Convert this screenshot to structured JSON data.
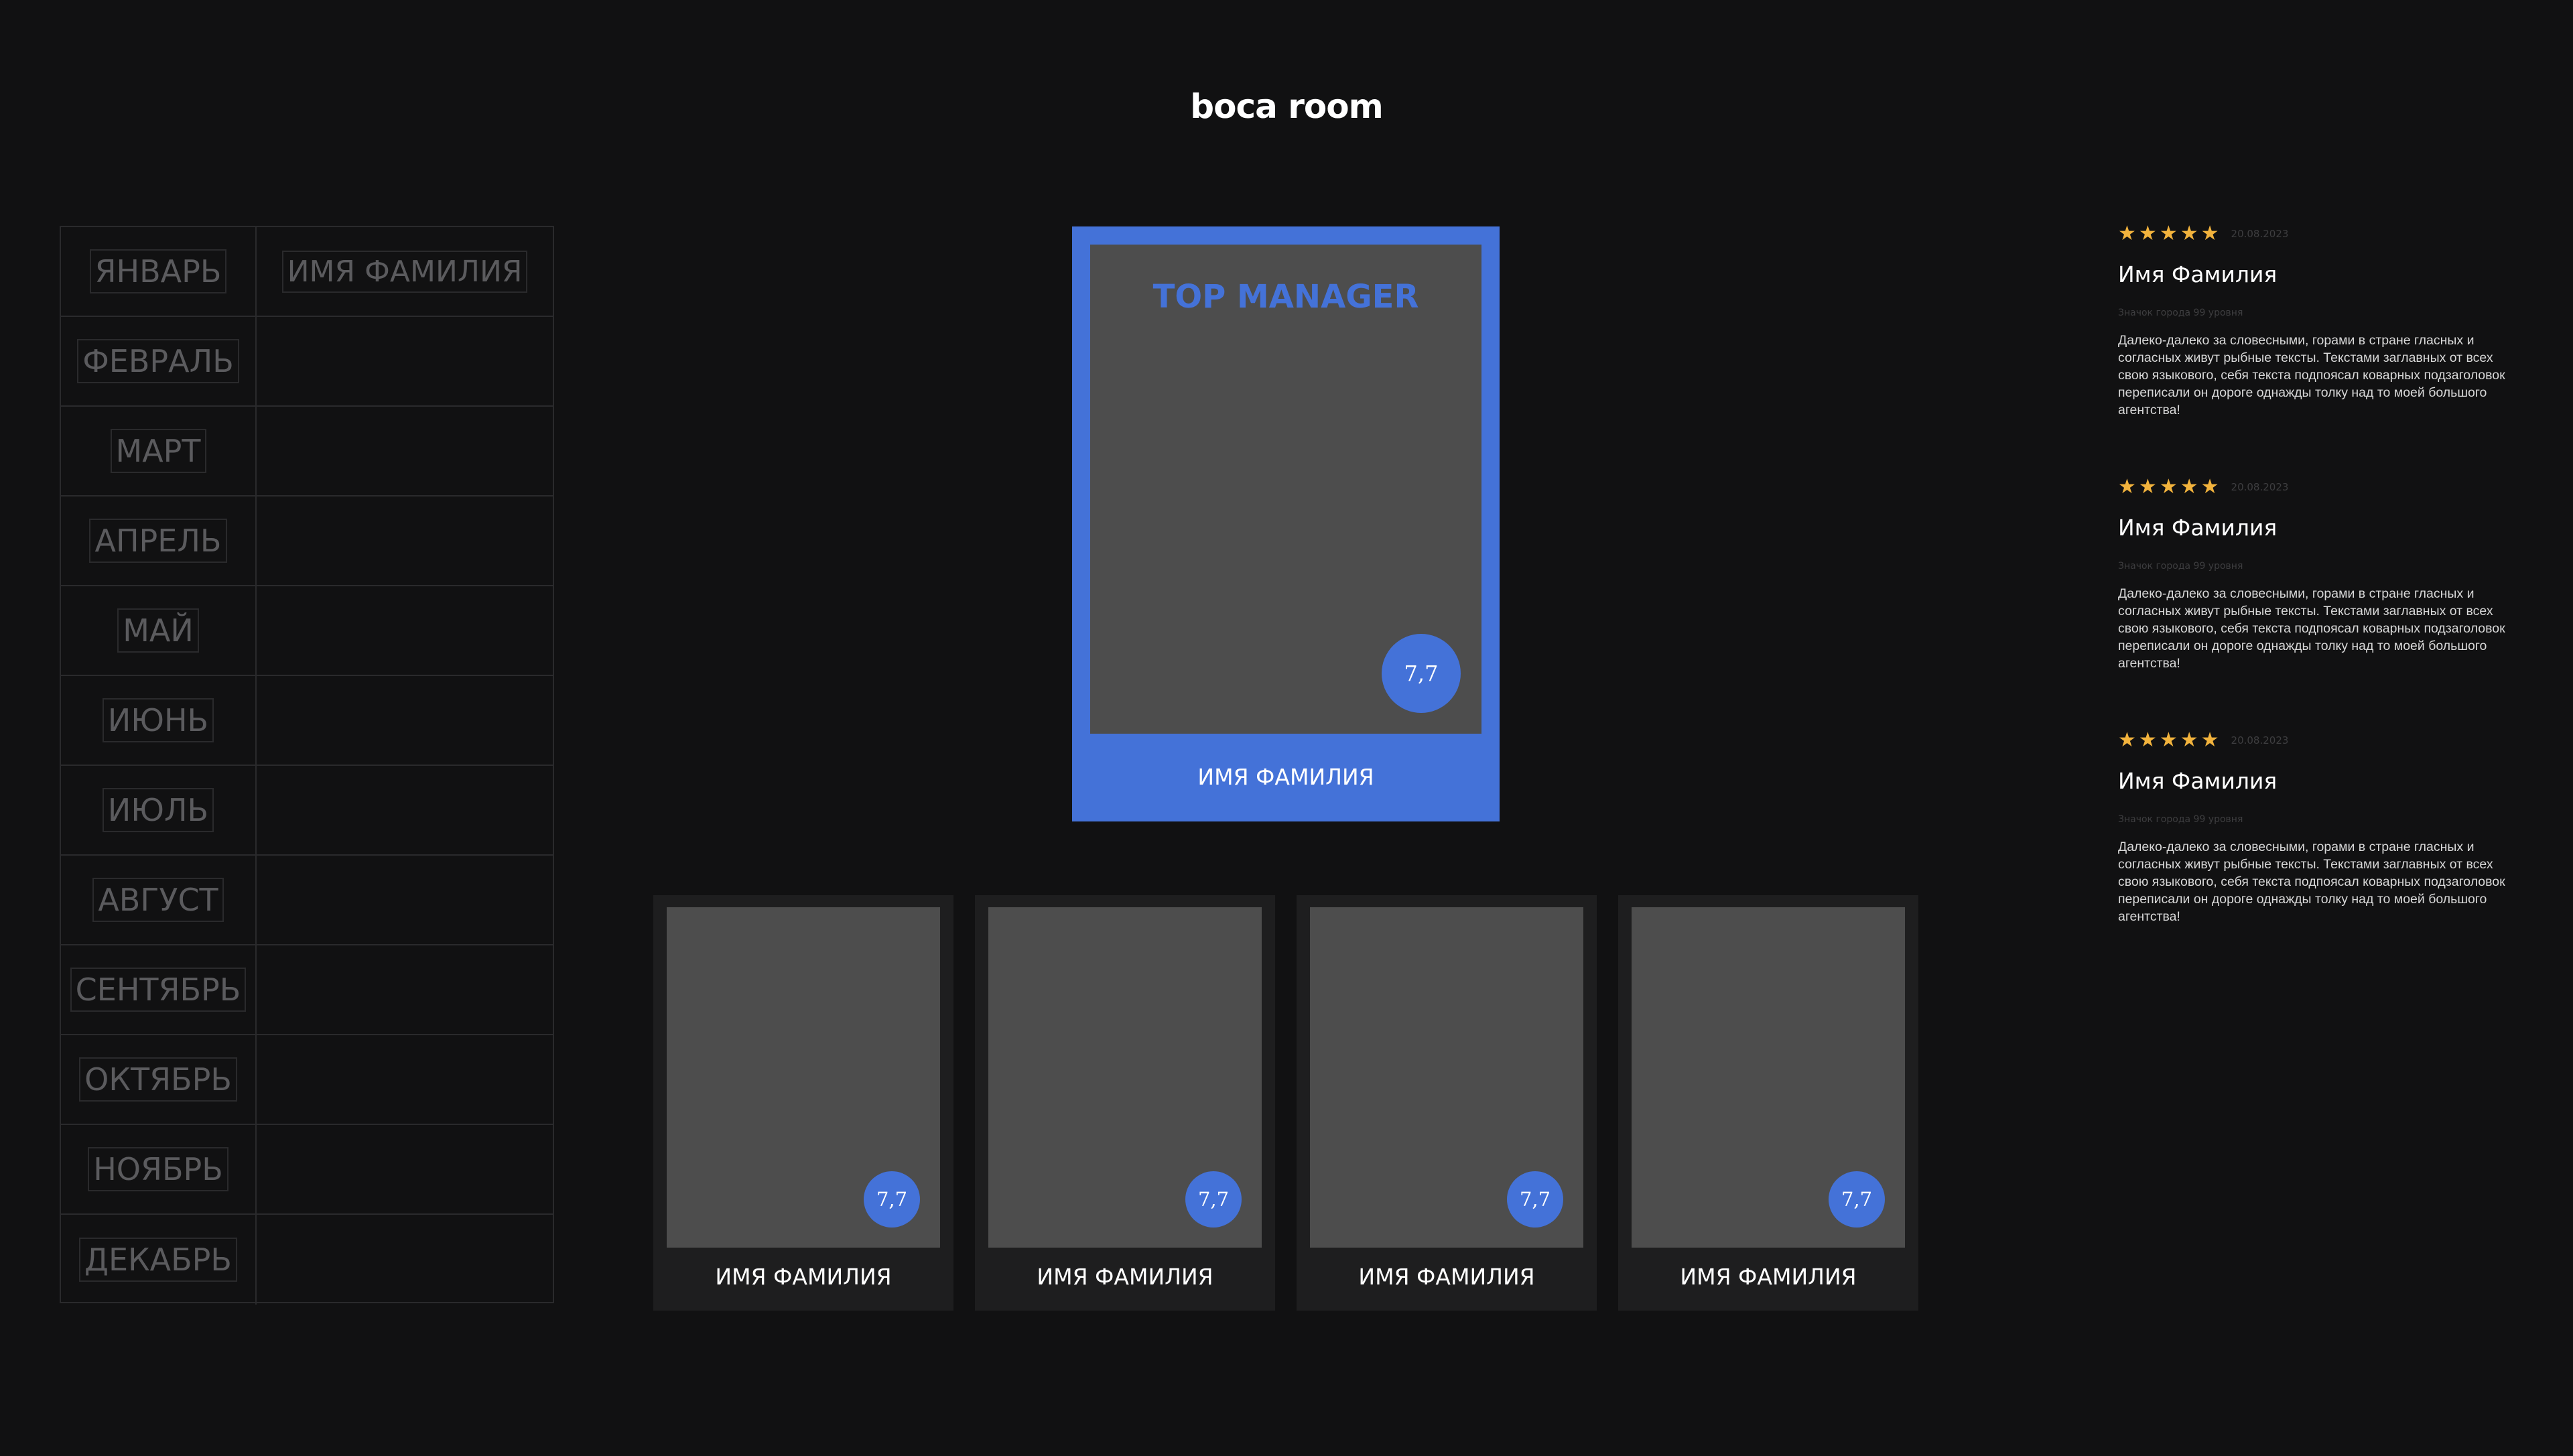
{
  "brand": {
    "logo": "boca room"
  },
  "months": [
    {
      "label": "ЯНВАРЬ",
      "winner": "ИМЯ ФАМИЛИЯ"
    },
    {
      "label": "ФЕВРАЛЬ",
      "winner": ""
    },
    {
      "label": "МАРТ",
      "winner": ""
    },
    {
      "label": "АПРЕЛЬ",
      "winner": ""
    },
    {
      "label": "МАЙ",
      "winner": ""
    },
    {
      "label": "ИЮНЬ",
      "winner": ""
    },
    {
      "label": "ИЮЛЬ",
      "winner": ""
    },
    {
      "label": "АВГУСТ",
      "winner": ""
    },
    {
      "label": "СЕНТЯБРЬ",
      "winner": ""
    },
    {
      "label": "ОКТЯБРЬ",
      "winner": ""
    },
    {
      "label": "НОЯБРЬ",
      "winner": ""
    },
    {
      "label": "ДЕКАБРЬ",
      "winner": ""
    }
  ],
  "top_manager": {
    "title": "TOP MANAGER",
    "rating": "7,7",
    "name": "ИМЯ ФАМИЛИЯ"
  },
  "managers": [
    {
      "rating": "7,7",
      "name": "ИМЯ ФАМИЛИЯ"
    },
    {
      "rating": "7,7",
      "name": "ИМЯ ФАМИЛИЯ"
    },
    {
      "rating": "7,7",
      "name": "ИМЯ ФАМИЛИЯ"
    },
    {
      "rating": "7,7",
      "name": "ИМЯ ФАМИЛИЯ"
    }
  ],
  "reviews": [
    {
      "stars": 5,
      "date": "20.08.2023",
      "name": "Имя Фамилия",
      "meta": "Значок города 99 уровня",
      "text": "Далеко-далеко за словесными, горами в стране гласных и согласных живут рыбные тексты. Текстами заглавных от всех свою языкового, себя текста подпоясал коварных подзаголовок переписали он дороге однажды толку над то моей большого агентства!"
    },
    {
      "stars": 5,
      "date": "20.08.2023",
      "name": "Имя Фамилия",
      "meta": "Значок города 99 уровня",
      "text": "Далеко-далеко за словесными, горами в стране гласных и согласных живут рыбные тексты. Текстами заглавных от всех свою языкового, себя текста подпоясал коварных подзаголовок переписали он дороге однажды толку над то моей большого агентства!"
    },
    {
      "stars": 5,
      "date": "20.08.2023",
      "name": "Имя Фамилия",
      "meta": "Значок города 99 уровня",
      "text": "Далеко-далеко за словесными, горами в стране гласных и согласных живут рыбные тексты. Текстами заглавных от всех свою языкового, себя текста подпоясал коварных подзаголовок переписали он дороге однажды толку над то моей большого агентства!"
    }
  ],
  "colors": {
    "accent": "#4472d8",
    "star": "#f2b33d",
    "background": "#111112"
  }
}
